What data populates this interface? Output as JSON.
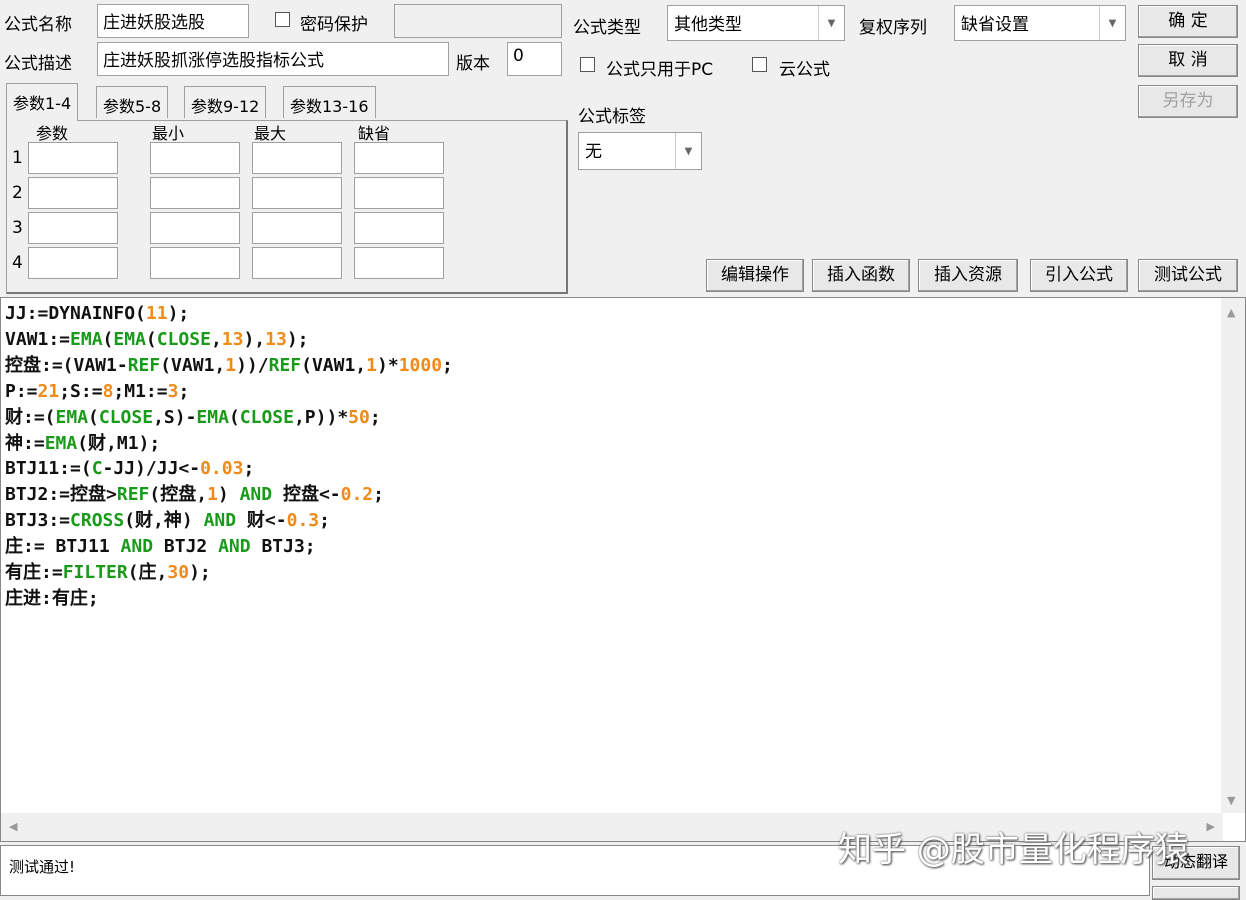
{
  "header": {
    "name_label": "公式名称",
    "name_value": "庄进妖股选股",
    "password_label": "密码保护",
    "password_value": "",
    "desc_label": "公式描述",
    "desc_value": "庄进妖股抓涨停选股指标公式",
    "version_label": "版本",
    "version_value": "0",
    "type_label": "公式类型",
    "type_value": "其他类型",
    "rights_label": "复权序列",
    "rights_value": "缺省设置",
    "pc_only_label": "公式只用于PC",
    "cloud_label": "云公式",
    "tag_label": "公式标签",
    "tag_value": "无"
  },
  "buttons": {
    "ok": "确 定",
    "cancel": "取 消",
    "save_as": "另存为",
    "edit_ops": "编辑操作",
    "insert_func": "插入函数",
    "insert_res": "插入资源",
    "import": "引入公式",
    "test": "测试公式",
    "dyn_translate": "动态翻译"
  },
  "tabs": [
    "参数1-4",
    "参数5-8",
    "参数9-12",
    "参数13-16"
  ],
  "params": {
    "headers": [
      "参数",
      "最小",
      "最大",
      "缺省"
    ],
    "rows": [
      "1",
      "2",
      "3",
      "4"
    ]
  },
  "code": [
    [
      [
        "t",
        "JJ:=DYNAINFO("
      ],
      [
        "n",
        "11"
      ],
      [
        "t",
        ");"
      ]
    ],
    [
      [
        "t",
        "VAW1:="
      ],
      [
        "f",
        "EMA"
      ],
      [
        "t",
        "("
      ],
      [
        "f",
        "EMA"
      ],
      [
        "t",
        "("
      ],
      [
        "f",
        "CLOSE"
      ],
      [
        "t",
        ","
      ],
      [
        "n",
        "13"
      ],
      [
        "t",
        "),"
      ],
      [
        "n",
        "13"
      ],
      [
        "t",
        ");"
      ]
    ],
    [
      [
        "t",
        "控盘:=(VAW1-"
      ],
      [
        "f",
        "REF"
      ],
      [
        "t",
        "(VAW1,"
      ],
      [
        "n",
        "1"
      ],
      [
        "t",
        "))/"
      ],
      [
        "f",
        "REF"
      ],
      [
        "t",
        "(VAW1,"
      ],
      [
        "n",
        "1"
      ],
      [
        "t",
        ")*"
      ],
      [
        "n",
        "1000"
      ],
      [
        "t",
        ";"
      ]
    ],
    [
      [
        "t",
        "P:="
      ],
      [
        "n",
        "21"
      ],
      [
        "t",
        ";S:="
      ],
      [
        "n",
        "8"
      ],
      [
        "t",
        ";M1:="
      ],
      [
        "n",
        "3"
      ],
      [
        "t",
        ";"
      ]
    ],
    [
      [
        "t",
        "财:=("
      ],
      [
        "f",
        "EMA"
      ],
      [
        "t",
        "("
      ],
      [
        "f",
        "CLOSE"
      ],
      [
        "t",
        ",S)-"
      ],
      [
        "f",
        "EMA"
      ],
      [
        "t",
        "("
      ],
      [
        "f",
        "CLOSE"
      ],
      [
        "t",
        ",P))*"
      ],
      [
        "n",
        "50"
      ],
      [
        "t",
        ";"
      ]
    ],
    [
      [
        "t",
        "神:="
      ],
      [
        "f",
        "EMA"
      ],
      [
        "t",
        "(财,M1);"
      ]
    ],
    [
      [
        "t",
        "BTJ11:=("
      ],
      [
        "f",
        "C"
      ],
      [
        "t",
        "-JJ)/JJ<-"
      ],
      [
        "n",
        "0.03"
      ],
      [
        "t",
        ";"
      ]
    ],
    [
      [
        "t",
        "BTJ2:=控盘>"
      ],
      [
        "f",
        "REF"
      ],
      [
        "t",
        "(控盘,"
      ],
      [
        "n",
        "1"
      ],
      [
        "t",
        ") "
      ],
      [
        "f",
        "AND"
      ],
      [
        "t",
        " 控盘<-"
      ],
      [
        "n",
        "0.2"
      ],
      [
        "t",
        ";"
      ]
    ],
    [
      [
        "t",
        "BTJ3:="
      ],
      [
        "f",
        "CROSS"
      ],
      [
        "t",
        "(财,神) "
      ],
      [
        "f",
        "AND"
      ],
      [
        "t",
        " 财<-"
      ],
      [
        "n",
        "0.3"
      ],
      [
        "t",
        ";"
      ]
    ],
    [
      [
        "t",
        "庄:= BTJ11 "
      ],
      [
        "f",
        "AND"
      ],
      [
        "t",
        " BTJ2 "
      ],
      [
        "f",
        "AND"
      ],
      [
        "t",
        " BTJ3;"
      ]
    ],
    [
      [
        "t",
        "有庄:="
      ],
      [
        "f",
        "FILTER"
      ],
      [
        "t",
        "(庄,"
      ],
      [
        "n",
        "30"
      ],
      [
        "t",
        ");"
      ]
    ],
    [
      [
        "t",
        "庄进:有庄;"
      ]
    ]
  ],
  "status": "测试通过!",
  "watermark": "知乎 @股市量化程序猿"
}
